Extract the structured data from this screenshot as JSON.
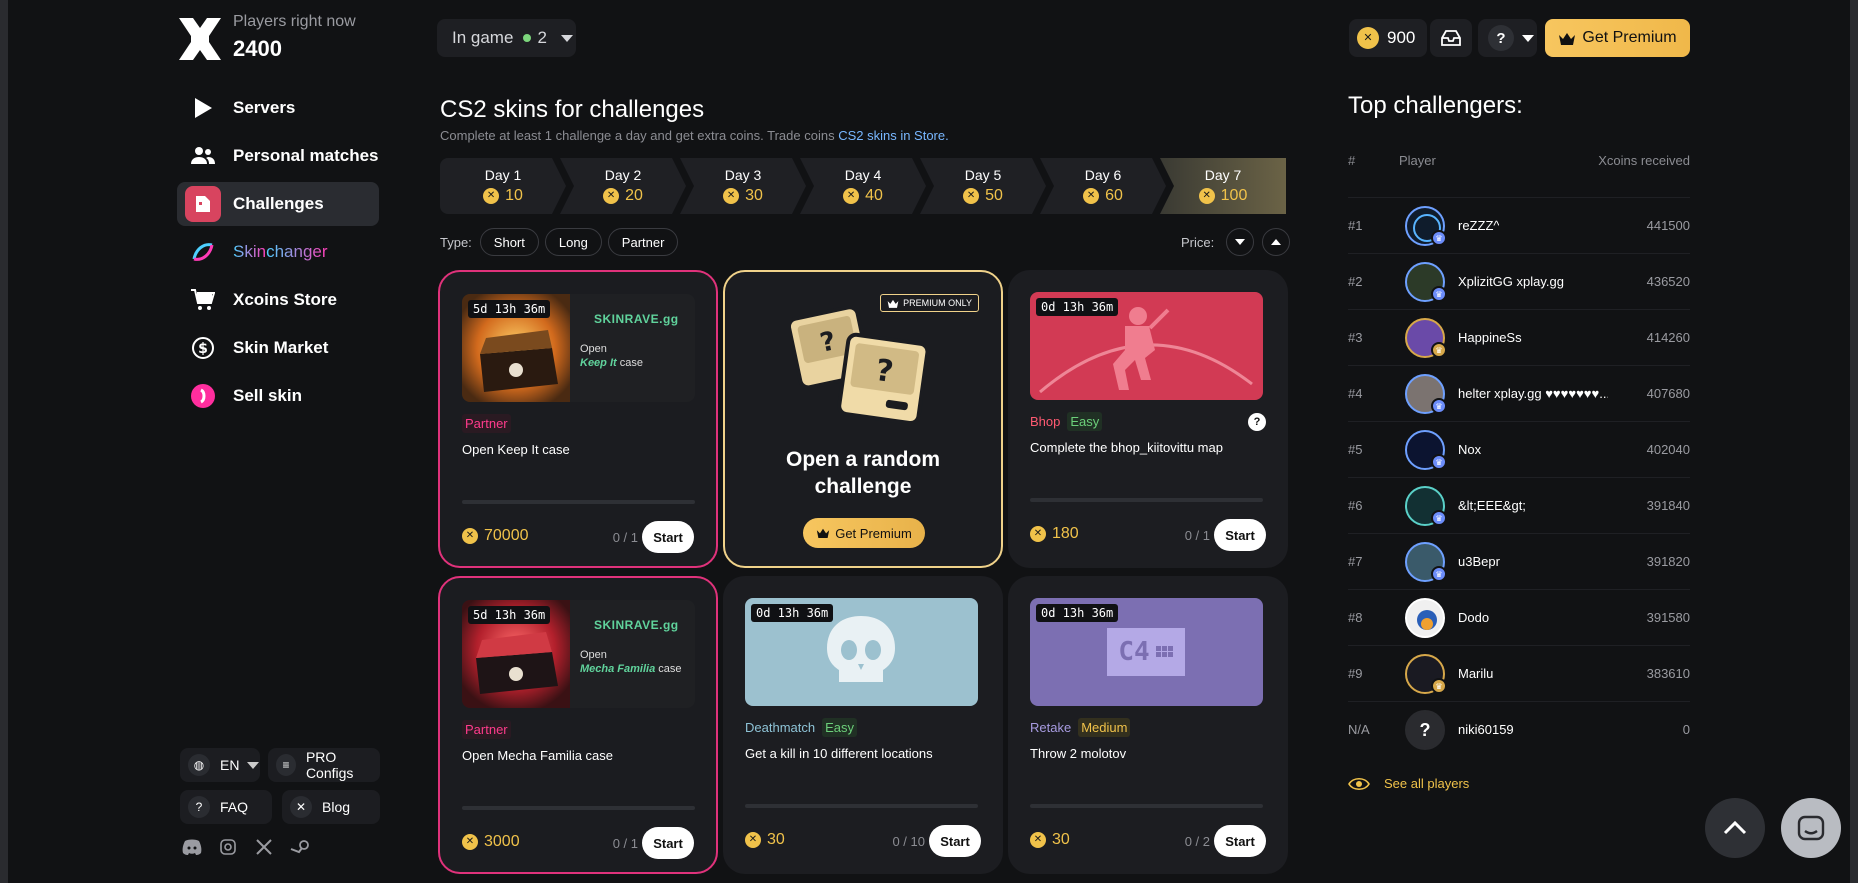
{
  "brand": {
    "players_label": "Players right now",
    "players_count": "2400"
  },
  "nav": [
    {
      "label": "Servers",
      "icon": "play-icon"
    },
    {
      "label": "Personal matches",
      "icon": "users-icon"
    },
    {
      "label": "Challenges",
      "icon": "challenges-icon",
      "active": true
    },
    {
      "label_a": "Skin",
      "label_b": "changer",
      "icon": "skinchanger-icon"
    },
    {
      "label": "Xcoins Store",
      "icon": "cart-icon"
    },
    {
      "label": "Skin Market",
      "icon": "dollar-icon"
    },
    {
      "label": "Sell skin",
      "icon": "sell-icon"
    }
  ],
  "footer": {
    "lang": "EN",
    "pro_configs": "PRO Configs",
    "faq": "FAQ",
    "blog": "Blog",
    "socials": [
      "discord-icon",
      "instagram-icon",
      "x-icon",
      "steam-icon"
    ]
  },
  "topbar": {
    "in_game_label": "In game",
    "in_game_count": "2",
    "coins": "900",
    "help": "?",
    "premium_label": "Get Premium"
  },
  "main": {
    "title": "CS2 skins for challenges",
    "subtitle_pre": "Complete at least 1 challenge a day and get extra coins. Trade coins ",
    "subtitle_link": "CS2 skins in Store.",
    "days": [
      {
        "name": "Day 1",
        "value": "10"
      },
      {
        "name": "Day 2",
        "value": "20"
      },
      {
        "name": "Day 3",
        "value": "30"
      },
      {
        "name": "Day 4",
        "value": "40"
      },
      {
        "name": "Day 5",
        "value": "50"
      },
      {
        "name": "Day 6",
        "value": "60"
      },
      {
        "name": "Day 7",
        "value": "100"
      }
    ],
    "filters": {
      "type_label": "Type:",
      "types": [
        "Short",
        "Long",
        "Partner"
      ],
      "price_label": "Price:"
    },
    "cards": [
      {
        "timer": "5d 13h 36m",
        "brand": "SKINRAVE.gg",
        "open": "Open",
        "item": "Keep It",
        "case": "case",
        "tags": [
          "Partner"
        ],
        "text": "Open Keep It case",
        "reward": "70000",
        "count": "0 / 1",
        "start": "Start"
      },
      {
        "badge": "PREMIUM ONLY",
        "title_l1": "Open a random",
        "title_l2": "challenge",
        "button": "Get Premium"
      },
      {
        "timer": "0d 13h 36m",
        "tags": [
          "Bhop",
          "Easy"
        ],
        "help": "?",
        "text": "Complete the bhop_kiitovittu map",
        "reward": "180",
        "count": "0 / 1",
        "start": "Start"
      },
      {
        "timer": "5d 13h 36m",
        "brand": "SKINRAVE.gg",
        "open": "Open",
        "item": "Mecha Familia",
        "case": "case",
        "tags": [
          "Partner"
        ],
        "text": "Open Mecha Familia case",
        "reward": "3000",
        "count": "0 / 1",
        "start": "Start"
      },
      {
        "timer": "0d 13h 36m",
        "tags": [
          "Deathmatch",
          "Easy"
        ],
        "text": "Get a kill in 10 different locations",
        "reward": "30",
        "count": "0 / 10",
        "start": "Start"
      },
      {
        "timer": "0d 13h 36m",
        "img_text": "C4",
        "tags": [
          "Retake",
          "Medium"
        ],
        "text": "Throw 2 molotov",
        "reward": "30",
        "count": "0 / 2",
        "start": "Start"
      }
    ]
  },
  "leaderboard": {
    "title": "Top challengers:",
    "headers": {
      "rank": "#",
      "player": "Player",
      "value": "Xcoins received"
    },
    "rows": [
      {
        "rank": "#1",
        "name": "reZZZ^",
        "value": "441500"
      },
      {
        "rank": "#2",
        "name": "XplizitGG xplay.gg",
        "value": "436520"
      },
      {
        "rank": "#3",
        "name": "HappineSs",
        "value": "414260"
      },
      {
        "rank": "#4",
        "name": "helter xplay.gg ♥♥♥♥♥♥♥...",
        "value": "407680"
      },
      {
        "rank": "#5",
        "name": "Nox",
        "value": "402040"
      },
      {
        "rank": "#6",
        "name": "&lt;EEE&gt;",
        "value": "391840"
      },
      {
        "rank": "#7",
        "name": "u3Bepr",
        "value": "391820"
      },
      {
        "rank": "#8",
        "name": "Dodo",
        "value": "391580"
      },
      {
        "rank": "#9",
        "name": "Marilu",
        "value": "383610"
      },
      {
        "rank": "N/A",
        "name": "niki60159",
        "value": "0"
      }
    ],
    "see_all": "See all players"
  },
  "colors": {
    "accent": "#f0c24a",
    "partner": "#e0327b",
    "premium": "#f0d28a",
    "bg": "#111214"
  }
}
